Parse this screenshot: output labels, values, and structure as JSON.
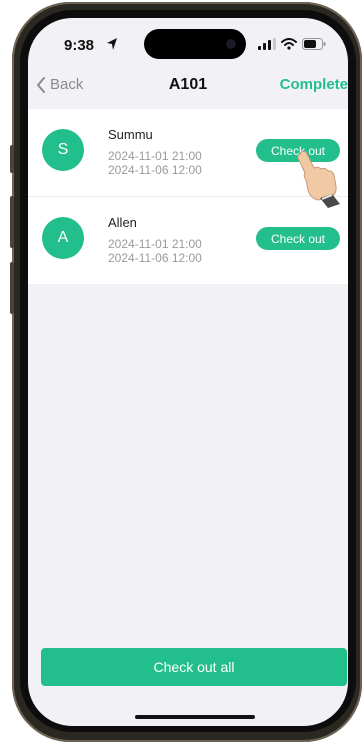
{
  "status_bar": {
    "time": "9:38"
  },
  "nav": {
    "back_label": "Back",
    "title": "A101",
    "complete_label": "Complete"
  },
  "guests": [
    {
      "initial": "S",
      "name": "Summu",
      "check_in": "2024-11-01 21:00",
      "check_out": "2024-11-06 12:00",
      "button_label": "Check out"
    },
    {
      "initial": "A",
      "name": "Allen",
      "check_in": "2024-11-01 21:00",
      "check_out": "2024-11-06 12:00",
      "button_label": "Check out"
    }
  ],
  "footer": {
    "checkout_all_label": "Check out all"
  },
  "colors": {
    "accent": "#22bf8c",
    "background": "#f2f2f6"
  }
}
